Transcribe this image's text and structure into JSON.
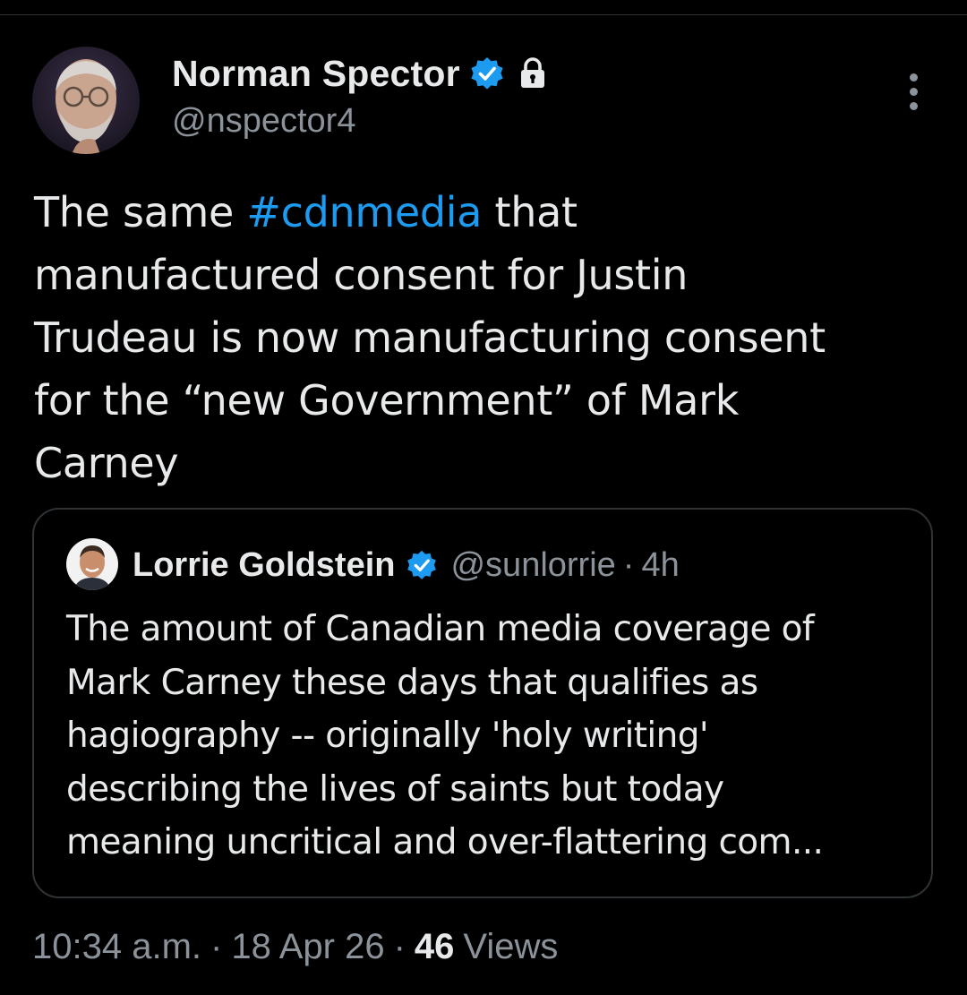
{
  "author": {
    "display_name": "Norman Spector",
    "handle": "@nspector4",
    "verified": true,
    "protected": true
  },
  "tweet": {
    "lines": [
      [
        {
          "text": "The same "
        },
        {
          "text": "#cdnmedia",
          "hashtag": true
        },
        {
          "text": " that"
        }
      ],
      [
        {
          "text": "manufactured consent for Justin"
        }
      ],
      [
        {
          "text": "Trudeau is now manufacturing consent"
        }
      ],
      [
        {
          "text": "for the “new Government” of Mark"
        }
      ],
      [
        {
          "text": "Carney"
        }
      ]
    ]
  },
  "quoted": {
    "display_name": "Lorrie Goldstein",
    "handle": "@sunlorrie",
    "separator": "·",
    "time": "4h",
    "verified": true,
    "lines": [
      "The amount of Canadian media coverage of",
      "Mark Carney these days that qualifies as",
      "hagiography -- originally 'holy writing'",
      "describing the lives of saints but today",
      "meaning uncritical and over-flattering  com..."
    ]
  },
  "meta": {
    "time": "10:34 a.m.",
    "separator": "·",
    "date": "18 Apr 26",
    "views_count": "46",
    "views_label": "Views"
  },
  "icons": {
    "verified_badge": "verified-badge-icon",
    "lock": "lock-icon",
    "more": "more-options-icon"
  },
  "colors": {
    "background": "#000000",
    "text": "#e7e9ea",
    "muted": "#8b9299",
    "accent": "#1d9bf0",
    "border": "#2f3336"
  }
}
